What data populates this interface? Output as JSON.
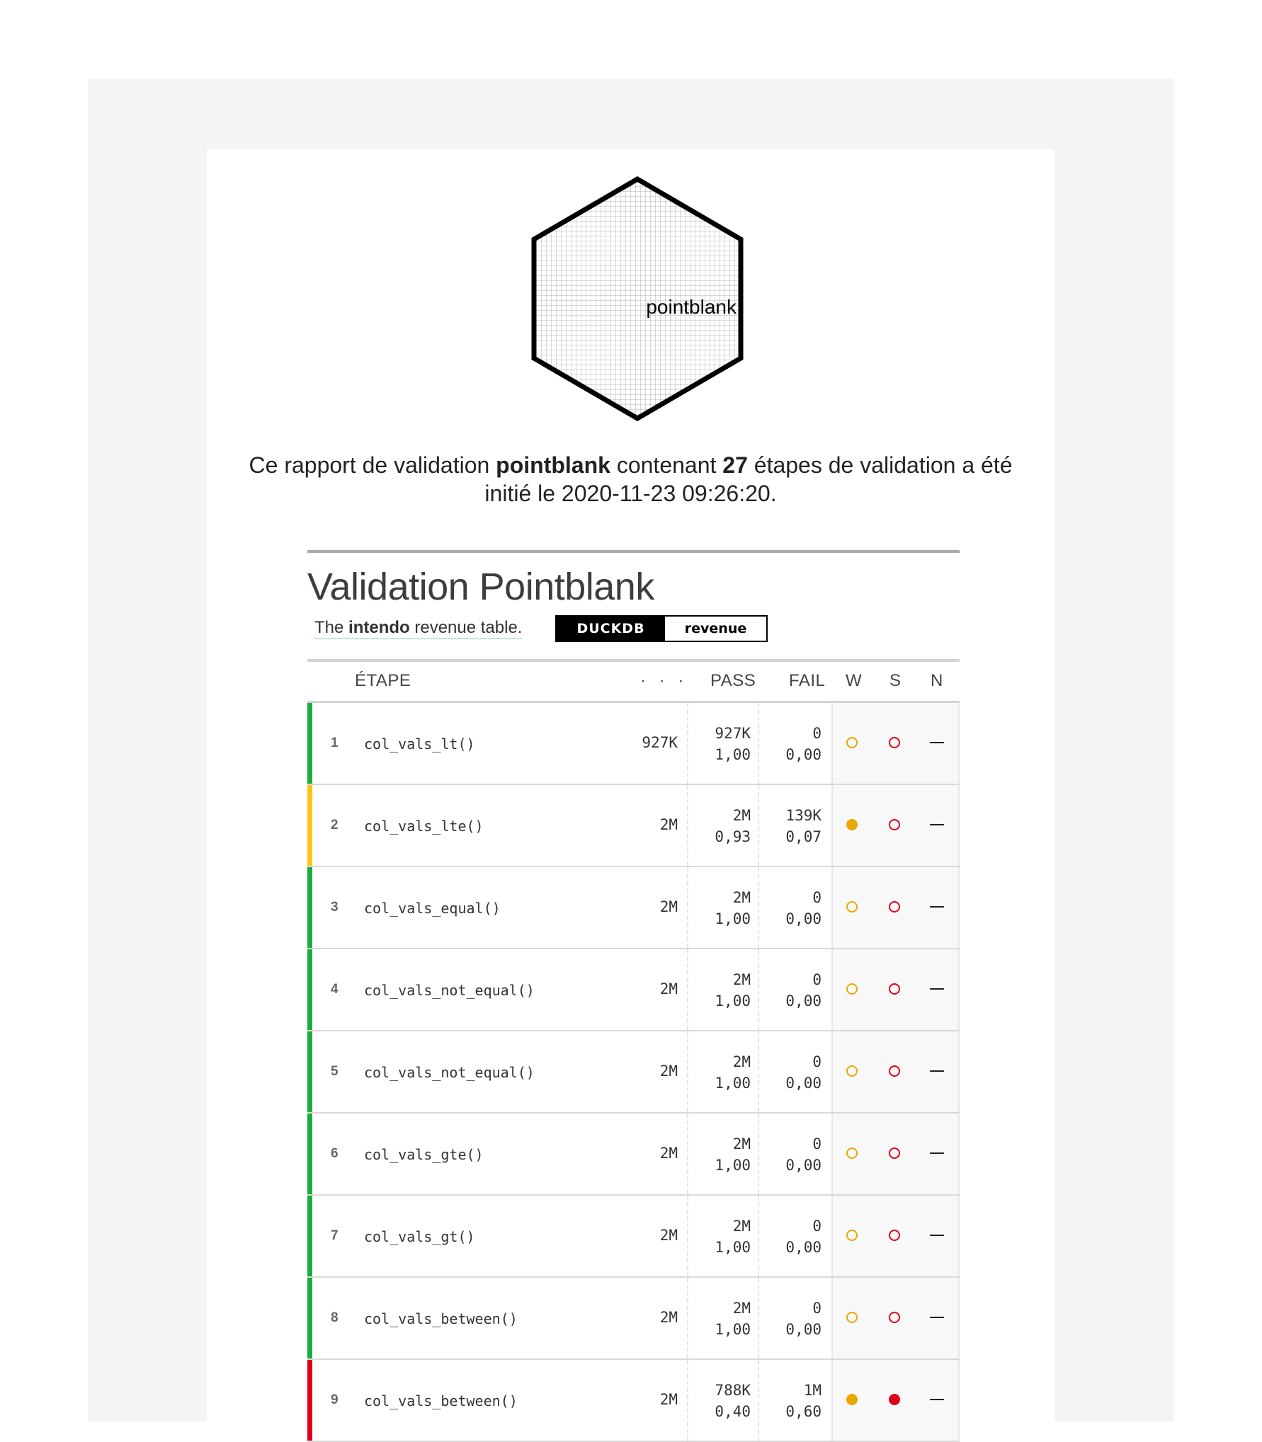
{
  "colors": {
    "pass_stripe": "#1aad3d",
    "warn_stripe": "#ffc414",
    "fail_stripe": "#e0001b",
    "warn_icon": "#e9a800",
    "stop_icon": "#e0001b"
  },
  "logo": {
    "text": "pointblank"
  },
  "intro": {
    "pre": "Ce rapport de validation ",
    "brand": "pointblank",
    "mid": " contenant ",
    "count": "27",
    "post1": " étapes de validation a été",
    "line2": "initié le 2020-11-23 09:26:20."
  },
  "report": {
    "title": "Validation Pointblank",
    "table_desc_pre": "The ",
    "table_desc_bold": "intendo",
    "table_desc_post": " revenue table.",
    "badge_engine": "DUCKDB",
    "badge_table": "revenue",
    "headers": {
      "step": "ÉTAPE",
      "units": "· · ·",
      "pass": "PASS",
      "fail": "FAIL",
      "w": "W",
      "s": "S",
      "n": "N"
    }
  },
  "rows": [
    {
      "num": "1",
      "fn": "col_vals_lt()",
      "units": "927K",
      "pass_n": "927K",
      "pass_f": "1,00",
      "fail_n": "0",
      "fail_f": "0,00",
      "status": "pass",
      "w": "open",
      "s": "open"
    },
    {
      "num": "2",
      "fn": "col_vals_lte()",
      "units": "2M",
      "pass_n": "2M",
      "pass_f": "0,93",
      "fail_n": "139K",
      "fail_f": "0,07",
      "status": "warn",
      "w": "filled",
      "s": "open"
    },
    {
      "num": "3",
      "fn": "col_vals_equal()",
      "units": "2M",
      "pass_n": "2M",
      "pass_f": "1,00",
      "fail_n": "0",
      "fail_f": "0,00",
      "status": "pass",
      "w": "open",
      "s": "open"
    },
    {
      "num": "4",
      "fn": "col_vals_not_equal()",
      "units": "2M",
      "pass_n": "2M",
      "pass_f": "1,00",
      "fail_n": "0",
      "fail_f": "0,00",
      "status": "pass",
      "w": "open",
      "s": "open"
    },
    {
      "num": "5",
      "fn": "col_vals_not_equal()",
      "units": "2M",
      "pass_n": "2M",
      "pass_f": "1,00",
      "fail_n": "0",
      "fail_f": "0,00",
      "status": "pass",
      "w": "open",
      "s": "open"
    },
    {
      "num": "6",
      "fn": "col_vals_gte()",
      "units": "2M",
      "pass_n": "2M",
      "pass_f": "1,00",
      "fail_n": "0",
      "fail_f": "0,00",
      "status": "pass",
      "w": "open",
      "s": "open"
    },
    {
      "num": "7",
      "fn": "col_vals_gt()",
      "units": "2M",
      "pass_n": "2M",
      "pass_f": "1,00",
      "fail_n": "0",
      "fail_f": "0,00",
      "status": "pass",
      "w": "open",
      "s": "open"
    },
    {
      "num": "8",
      "fn": "col_vals_between()",
      "units": "2M",
      "pass_n": "2M",
      "pass_f": "1,00",
      "fail_n": "0",
      "fail_f": "0,00",
      "status": "pass",
      "w": "open",
      "s": "open"
    },
    {
      "num": "9",
      "fn": "col_vals_between()",
      "units": "2M",
      "pass_n": "788K",
      "pass_f": "0,40",
      "fail_n": "1M",
      "fail_f": "0,60",
      "status": "fail",
      "w": "filled",
      "s": "filled"
    }
  ]
}
